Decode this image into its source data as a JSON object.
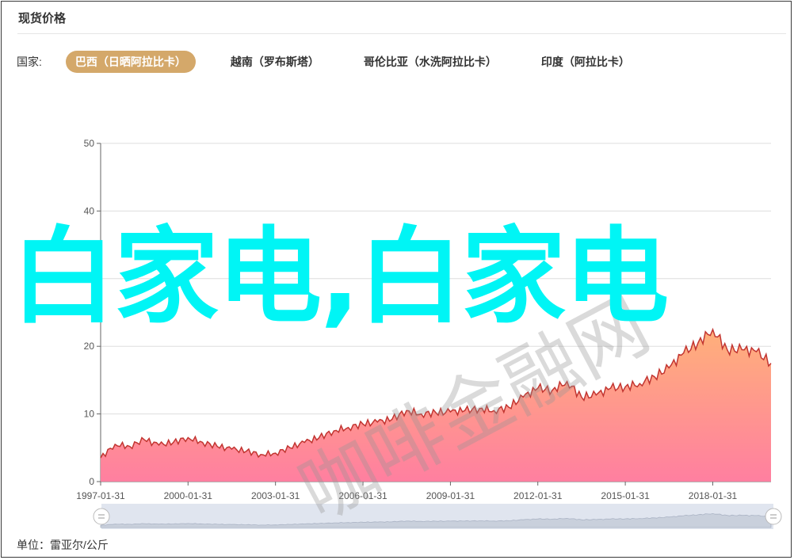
{
  "panel": {
    "title": "现货价格"
  },
  "filters": {
    "label": "国家:",
    "countries": [
      {
        "label": "巴西（日晒阿拉比卡）",
        "active": true
      },
      {
        "label": "越南（罗布斯塔）",
        "active": false
      },
      {
        "label": "哥伦比亚（水洗阿拉比卡）",
        "active": false
      },
      {
        "label": "印度（阿拉比卡）",
        "active": false
      }
    ]
  },
  "unit_label": "单位：雷亚尔/公斤",
  "overlay_text": "白家电,白家电",
  "watermark_text": "咖啡金融网",
  "colors": {
    "accent": "#d4a86a",
    "line": "#c23531",
    "fill_top": "#ffb07a",
    "fill_bottom": "#ff7fa0",
    "overlay": "#00f5f5"
  },
  "chart_data": {
    "type": "area",
    "x_tick_labels": [
      "1997-01-31",
      "2000-01-31",
      "2003-01-31",
      "2006-01-31",
      "2009-01-31",
      "2012-01-31",
      "2015-01-31",
      "2018-01-31"
    ],
    "y_ticks": [
      0,
      10,
      20,
      30,
      40,
      50
    ],
    "ylim": [
      0,
      50
    ],
    "xlim": [
      "1997-01-31",
      "2020-01-31"
    ],
    "grid": true,
    "series": [
      {
        "x": [
          "1997-01-31",
          "1997-07-31",
          "1998-01-31",
          "1998-07-31",
          "1999-01-31",
          "1999-07-31",
          "2000-01-31",
          "2000-07-31",
          "2001-01-31",
          "2001-07-31",
          "2002-01-31",
          "2002-07-31",
          "2003-01-31",
          "2003-07-31",
          "2004-01-31",
          "2004-07-31",
          "2005-01-31",
          "2005-07-31",
          "2006-01-31",
          "2006-07-31",
          "2007-01-31",
          "2007-07-31",
          "2008-01-31",
          "2008-07-31",
          "2009-01-31",
          "2009-07-31",
          "2010-01-31",
          "2010-07-31",
          "2011-01-31",
          "2011-07-31",
          "2012-01-31",
          "2012-07-31",
          "2013-01-31",
          "2013-07-31",
          "2014-01-31",
          "2014-07-31",
          "2015-01-31",
          "2015-07-31",
          "2016-01-31",
          "2016-07-31",
          "2017-01-31",
          "2017-07-31",
          "2018-01-31",
          "2018-07-31",
          "2019-01-31",
          "2019-07-31",
          "2020-01-31"
        ],
        "values": [
          3.5,
          5.5,
          5.2,
          6.2,
          5.4,
          5.8,
          6.5,
          5.8,
          5.2,
          4.8,
          4.5,
          4.0,
          4.2,
          5.0,
          5.8,
          6.5,
          7.5,
          8.0,
          8.5,
          8.8,
          9.2,
          10.5,
          10.0,
          10.2,
          10.3,
          10.5,
          10.8,
          10.5,
          11.0,
          12.5,
          13.8,
          13.5,
          14.8,
          12.5,
          12.8,
          13.8,
          14.0,
          14.5,
          15.5,
          16.8,
          19.0,
          20.5,
          22.5,
          19.5,
          19.5,
          19.2,
          17.5
        ]
      }
    ]
  }
}
